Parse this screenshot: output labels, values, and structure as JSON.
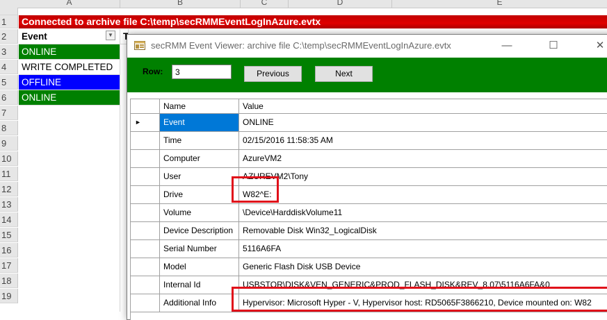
{
  "excel": {
    "columns": [
      "A",
      "B",
      "C",
      "D",
      "E"
    ],
    "row_numbers": [
      "1",
      "2",
      "3",
      "4",
      "5",
      "6",
      "7",
      "8",
      "9",
      "10",
      "11",
      "12",
      "13",
      "14",
      "15",
      "16",
      "17",
      "18",
      "19"
    ],
    "banner": "Connected to archive file C:\\temp\\secRMMEventLogInAzure.evtx",
    "header_a": "Event",
    "header_b": "T",
    "rows": [
      "ONLINE",
      "WRITE COMPLETED",
      "OFFLINE",
      "ONLINE"
    ],
    "colors": {
      "online": "#008000",
      "offline": "#0000ff",
      "banner": "#d00000"
    }
  },
  "window": {
    "title": "secRMM Event Viewer: archive file C:\\temp\\secRMMEventLogInAzure.evtx",
    "minimize": "—",
    "maximize": "☐",
    "close": "✕"
  },
  "toolbar": {
    "row_label": "Row:",
    "row_value": "3",
    "previous_label": "Previous",
    "next_label": "Next",
    "color": "#008000"
  },
  "grid": {
    "headers": {
      "name": "Name",
      "value": "Value"
    },
    "rows": [
      {
        "name": "Event",
        "value": "ONLINE"
      },
      {
        "name": "Time",
        "value": "02/15/2016 11:58:35 AM"
      },
      {
        "name": "Computer",
        "value": "AzureVM2"
      },
      {
        "name": "User",
        "value": "AZUREVM2\\Tony"
      },
      {
        "name": "Drive",
        "value": "W82^E:"
      },
      {
        "name": "Volume",
        "value": "\\Device\\HarddiskVolume11"
      },
      {
        "name": "Device Description",
        "value": "Removable Disk Win32_LogicalDisk"
      },
      {
        "name": "Serial Number",
        "value": "5116A6FA"
      },
      {
        "name": "Model",
        "value": "Generic Flash Disk USB Device"
      },
      {
        "name": "Internal Id",
        "value": "USBSTOR\\DISK&VEN_GENERIC&PROD_FLASH_DISK&REV_8.07\\5116A6FA&0"
      },
      {
        "name": "Additional Info",
        "value": "Hypervisor: Microsoft Hyper - V, Hypervisor host: RD5065F3866210, Device mounted on: W82"
      }
    ],
    "selected_row_marker": "►",
    "selection_color": "#0078d7",
    "highlight_color": "#e0101a"
  }
}
